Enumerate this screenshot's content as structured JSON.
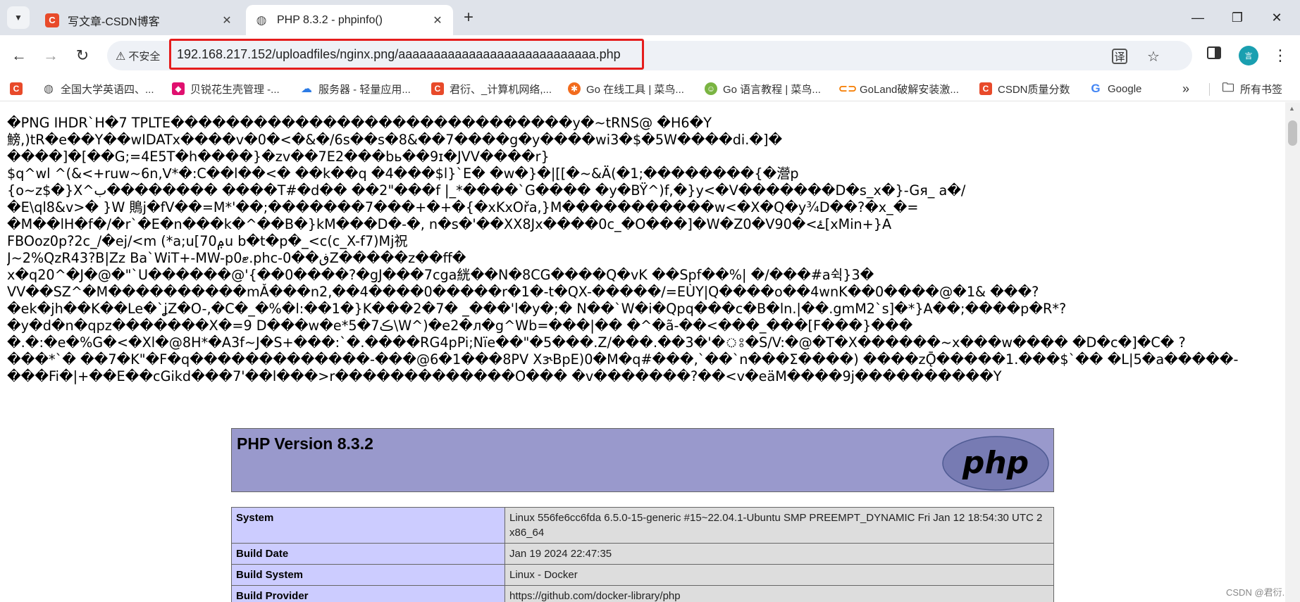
{
  "tabs": [
    {
      "title": "写文章-CSDN博客",
      "icon": "csdn-logo-icon",
      "active": false
    },
    {
      "title": "PHP 8.3.2 - phpinfo()",
      "icon": "globe-icon",
      "active": true
    }
  ],
  "window_controls": {
    "minimize": "—",
    "maximize": "❐",
    "close": "✕"
  },
  "toolbar": {
    "security_label": "不安全",
    "url": "192.168.217.152/uploadfiles/nginx.png/aaaaaaaaaaaaaaaaaaaaaaaaaaaa.php",
    "profile_initial": "言"
  },
  "bookmarks": [
    {
      "label": "",
      "icon": "csdn-logo-icon"
    },
    {
      "label": "全国大学英语四、...",
      "icon": "globe-icon"
    },
    {
      "label": "贝锐花生壳管理 -...",
      "icon": "cube-icon"
    },
    {
      "label": "服务器 - 轻量应用...",
      "icon": "cloud-icon"
    },
    {
      "label": "君衍、_计算机网络,...",
      "icon": "csdn-logo-icon"
    },
    {
      "label": "Go 在线工具 | 菜鸟...",
      "icon": "go-tool-icon"
    },
    {
      "label": "Go 语言教程 | 菜鸟...",
      "icon": "runoob-icon"
    },
    {
      "label": "GoLand破解安装激...",
      "icon": "goland-icon"
    },
    {
      "label": "CSDN质量分数",
      "icon": "csdn-logo-icon"
    },
    {
      "label": "Google",
      "icon": "google-icon"
    }
  ],
  "bookmarks_more": "»",
  "all_bookmarks_label": "所有书签",
  "garbage_lines": [
    "�PNG  IHDR`H�7 TPLTE�����������������������������y�~tRNS@ �H6�Y",
    "鰟,)tR�e��Y��wIDATx����v�0�<�&�/6s��s�8&��7����g�y����wi3�$�5W����di.�]�",
    "����]�[��G;=4E5T�h����}�zv��7E2���bь��9ɪ�JVV����r}",
    "$q^wl ^(&<+ruw~6n,ᐯ*�:C��l��<� ��k��q �4���$l}`E� �w�}�|[[�~&Ä(�1;��������{�瀯p",
    "{o~z$�}X^ب�������� ����T#�d�� ��2\"���f |_*����`G���� �y�BŸ^)f,�}y<�V�������D�s_x�}-Gя_ a�/",
    "�E\\ql8&v>� }W 鵙j�fV��=M*'��;�������7���+�+�{�xKxOřa,}M�����������w<�X�Q�y¾D��?�x_�=",
    "�M��lH�f�/�r`�E�n���k�^��B�}kM���D�-�, n�s�'��XX8Jx����0c_�O���]�W�Z0�V90�<ۓ[xMin+}A",
    "FBOoz0p?2c_/�ej/<m (*a;u[ݦ70u b�t�p�_<c(c_X-f7)Mj祝",
    "J~2%QzR43?B|Zz Ba`WiT+-MW-p0ޓ.phc-0��ڧZ�����z��ff�",
    "x�q20^�J�@�\"`U������@'{��0����?�gJ���7cga絖��N�8CG����Q�vK ��Spf��%| �/���#a쉭}3�",
    "VV��SZ^�M����������mǍ���n2,��4����0�����r�1�-t�QX-�����/=EÙY|Q����o��4wnK��0����@�1& ���?",
    "�ek�jh��K��Le�`ʝZ�O-,�C�_�%�l:��1�}K���2�7� _���'l�y�;� N��`W�i�Qpq���c�B�ln.|��.gmM2`s]�*}A��;����p�R*?",
    "�y�d�n�qpz�������X�=9 D���w�e*5�7ڪ\\W^)�e2�ᴫ�g^Wb=���|�� �^�ã-��<���_���[F���}���",
    "�.�:�e�%G�<�Xl�@8H*�A3f~J�S+���:`�.����RG4pPi;Nïe��\"�5���.Z/���.��3�'�ঃ�S/V:�@�T�X������~x���w����  �D�c�]�C� ?",
    "���*`� ��7�K\"�F�q�������������-���@6�1���8PV XɝBpE)0�M�q#���,`��`n���Σ����) ����zǬ�����1.���$`�� �L|5�a�����-",
    "���Fi�|+��E��cGikd���7'��l���>r�������������O��� �v�������?��<v�eäM����9j����������Y"
  ],
  "php": {
    "version_title": "PHP Version 8.3.2",
    "logo_text": "php",
    "rows": [
      {
        "key": "System",
        "value": "Linux 556fe6cc6fda 6.5.0-15-generic #15~22.04.1-Ubuntu SMP PREEMPT_DYNAMIC Fri Jan 12 18:54:30 UTC 2 x86_64"
      },
      {
        "key": "Build Date",
        "value": "Jan 19 2024 22:47:35"
      },
      {
        "key": "Build System",
        "value": "Linux - Docker"
      },
      {
        "key": "Build Provider",
        "value": "https://github.com/docker-library/php"
      }
    ]
  },
  "watermark": "CSDN @君衍."
}
